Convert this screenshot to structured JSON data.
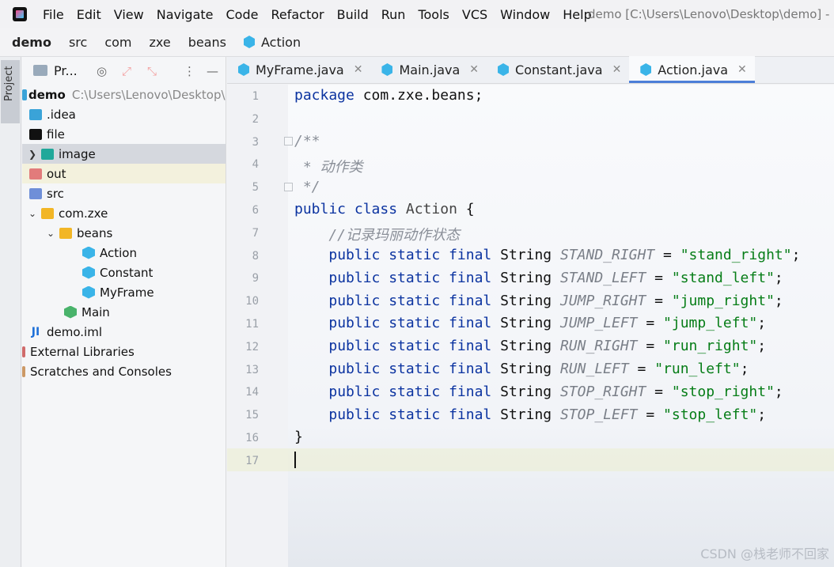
{
  "menubar": {
    "items": [
      "File",
      "Edit",
      "View",
      "Navigate",
      "Code",
      "Refactor",
      "Build",
      "Run",
      "Tools",
      "VCS",
      "Window",
      "Help"
    ],
    "window_title": "demo [C:\\Users\\Lenovo\\Desktop\\demo] -"
  },
  "breadcrumb": {
    "items": [
      "demo",
      "src",
      "com",
      "zxe",
      "beans",
      "Action"
    ]
  },
  "stripe": {
    "project_label": "Project"
  },
  "project_panel": {
    "title": "Pr...",
    "tree": [
      {
        "label": "demo",
        "hint": "C:\\Users\\Lenovo\\Desktop\\c"
      },
      {
        "label": ".idea"
      },
      {
        "label": "file"
      },
      {
        "label": "image"
      },
      {
        "label": "out"
      },
      {
        "label": "src"
      },
      {
        "label": "com.zxe"
      },
      {
        "label": "beans"
      },
      {
        "label": "Action"
      },
      {
        "label": "Constant"
      },
      {
        "label": "MyFrame"
      },
      {
        "label": "Main"
      },
      {
        "label": "demo.iml"
      },
      {
        "label": "External Libraries"
      },
      {
        "label": "Scratches and Consoles"
      }
    ]
  },
  "tabs": [
    {
      "label": "MyFrame.java"
    },
    {
      "label": "Main.java"
    },
    {
      "label": "Constant.java"
    },
    {
      "label": "Action.java"
    }
  ],
  "editor": {
    "line_numbers": [
      "1",
      "2",
      "3",
      "4",
      "5",
      "6",
      "7",
      "8",
      "9",
      "10",
      "11",
      "12",
      "13",
      "14",
      "15",
      "16",
      "17"
    ],
    "code": {
      "l1_kw": "package",
      "l1_rest": " com.zxe.beans;",
      "l3": "/**",
      "l4": " * 动作类",
      "l5": " */",
      "l6_kw": "public class",
      "l6_name": " Action",
      "l6_rest": " {",
      "l7": "    //记录玛丽动作状态",
      "l16": "}",
      "fields": [
        {
          "name": "STAND_RIGHT",
          "value": "\"stand_right\""
        },
        {
          "name": "STAND_LEFT",
          "value": "\"stand_left\""
        },
        {
          "name": "JUMP_RIGHT",
          "value": "\"jump_right\""
        },
        {
          "name": "JUMP_LEFT",
          "value": "\"jump_left\""
        },
        {
          "name": "RUN_RIGHT",
          "value": "\"run_right\""
        },
        {
          "name": "RUN_LEFT",
          "value": "\"run_left\""
        },
        {
          "name": "STOP_RIGHT",
          "value": "\"stop_right\""
        },
        {
          "name": "STOP_LEFT",
          "value": "\"stop_left\""
        }
      ],
      "field_modifiers": "public static final",
      "field_type": " String ",
      "assign": " = ",
      "semicolon": ";"
    }
  },
  "watermark": "CSDN @栈老师不回家"
}
